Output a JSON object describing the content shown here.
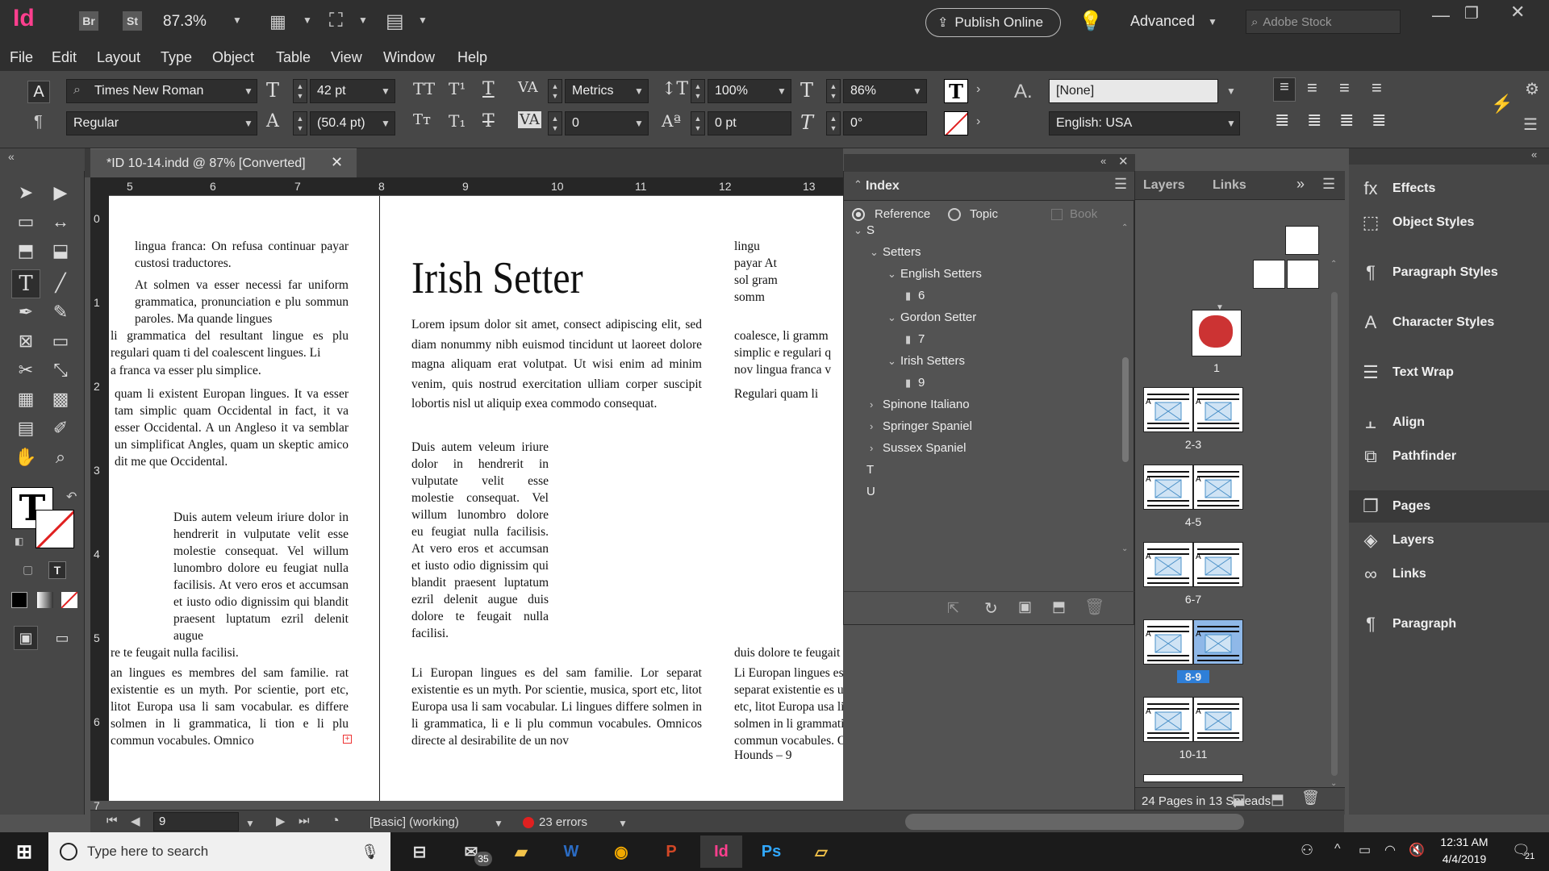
{
  "app": {
    "logo": "Id",
    "bridge": "Br",
    "stock": "St",
    "zoom": "87.3%",
    "publish": "Publish Online",
    "workspace": "Advanced",
    "search_placeholder": "Adobe Stock"
  },
  "menu": [
    "File",
    "Edit",
    "Layout",
    "Type",
    "Object",
    "Table",
    "View",
    "Window",
    "Help"
  ],
  "control": {
    "font": "Times New Roman",
    "style": "Regular",
    "size": "42 pt",
    "leading": "(50.4 pt)",
    "kerning": "Metrics",
    "tracking": "0",
    "vscale": "100%",
    "baseline": "0 pt",
    "hscale": "86%",
    "skew": "0°",
    "char_style": "[None]",
    "language": "English: USA"
  },
  "doc": {
    "tab": "*ID 10-14.indd @ 87% [Converted]",
    "ruler_h": [
      "5",
      "6",
      "7",
      "8",
      "9",
      "10",
      "11",
      "12",
      "13"
    ],
    "ruler_v": [
      "0",
      "1",
      "2",
      "3",
      "4",
      "5",
      "6",
      "7"
    ],
    "left_page": [
      "lingua franca: On refusa continuar payar custosi traductores.",
      "At solmen va esser necessi far uniform grammatica, pronunciation e plu sommun paroles. Ma quande lingues",
      "li grammatica del resultant lingue es plu regulari quam ti del coalescent lingues. Li",
      "a franca va esser plu simplice.",
      "quam li existent Europan lingues. It va esser tam simplic quam Occidental in fact, it va esser Occidental. A un Angleso it va semblar un simplificat Angles, quam un skeptic amico dit me que Occidental.",
      "Duis autem veleum iriure dolor in hendrerit in vulputate velit esse molestie consequat. Vel willum lunombro dolore eu feugiat nulla facilisis. At vero eros et accumsan et iusto odio dignissim qui blandit praesent luptatum ezril delenit augue",
      "re te feugait nulla facilisi.",
      "an lingues es membres del sam familie. rat existentie es un myth. Por scientie, port etc, litot Europa usa li sam vocabular. es differe solmen in li grammatica, li tion e li plu commun vocabules. Omnico"
    ],
    "heading": "Irish Setter",
    "lorem": "Lorem ipsum dolor sit amet, consect adipiscing elit, sed diam nonummy nibh euismod tincidunt ut laoreet dolore magna aliquam erat volutpat. Ut wisi enim ad minim venim, quis nostrud exercitation ulliam corper suscipit lobortis nisl ut aliquip exea commodo consequat.",
    "duis": "Duis autem veleum iriure dolor in hendrerit in vulputate velit esse molestie consequat. Vel willum lunombro dolore eu feugiat nulla facilisis. At vero eros et accumsan et iusto odio dignissim qui blandit praesent luptatum ezril delenit augue duis dolore te feugait nulla facilisi.",
    "li_europan": "Li Europan lingues es del sam familie. Lor separat existentie es un myth. Por scientie, musica, sport etc, litot Europa usa li sam vocabular. Li lingues differe solmen in li grammatica, li e li plu commun vocabules. Omnicos directe al desirabilite de un nov",
    "right_top": "lingu payar At sol gram somm",
    "right_mid": "coalesce, li gramm simplic e regulari q nov lingua franca v",
    "right_reg": "Regulari quam li",
    "right_dup": "duis dolore te feugait nulla facilisi.",
    "right_bottom": "Li Europan lingues es membres del sam familie. Lor separat existentie es un myth. Por scientie, musica, sport etc, litot Europa usa li sam vocabular. Li lingues differe solmen in li grammatica, li pronunciation e li plu commun vocabules. Omnico",
    "footer": "Hounds –  9"
  },
  "index": {
    "title": "Index",
    "reference": "Reference",
    "topic": "Topic",
    "book": "Book",
    "tree": [
      {
        "label": "S",
        "level": 0,
        "open": true
      },
      {
        "label": "Setters",
        "level": 1,
        "open": true
      },
      {
        "label": "English Setters",
        "level": 2,
        "open": true
      },
      {
        "label": "6",
        "level": 3,
        "page": true
      },
      {
        "label": "Gordon Setter",
        "level": 2,
        "open": true
      },
      {
        "label": "7",
        "level": 3,
        "page": true
      },
      {
        "label": "Irish Setters",
        "level": 2,
        "open": true
      },
      {
        "label": "9",
        "level": 3,
        "page": true
      },
      {
        "label": "Spinone Italiano",
        "level": 1,
        "open": false
      },
      {
        "label": "Springer Spaniel",
        "level": 1,
        "open": false
      },
      {
        "label": "Sussex Spaniel",
        "level": 1,
        "open": false
      },
      {
        "label": "T",
        "level": 0,
        "leaf": true
      },
      {
        "label": "U",
        "level": 0,
        "leaf": true
      }
    ]
  },
  "pages": {
    "tabs": [
      "Layers",
      "Links"
    ],
    "spreads": [
      "1",
      "2-3",
      "4-5",
      "6-7",
      "8-9",
      "10-11"
    ],
    "selected": "8-9",
    "summary": "24 Pages in 13 Spreads"
  },
  "dock": [
    "Effects",
    "Object Styles",
    "Paragraph Styles",
    "Character Styles",
    "Text Wrap",
    "Align",
    "Pathfinder",
    "Pages",
    "Layers",
    "Links",
    "Paragraph"
  ],
  "status": {
    "page": "9",
    "style": "[Basic] (working)",
    "errors": "23 errors"
  },
  "taskbar": {
    "search": "Type here to search",
    "mail_badge": "35",
    "time": "12:31 AM",
    "date": "4/4/2019",
    "notif": "21"
  }
}
